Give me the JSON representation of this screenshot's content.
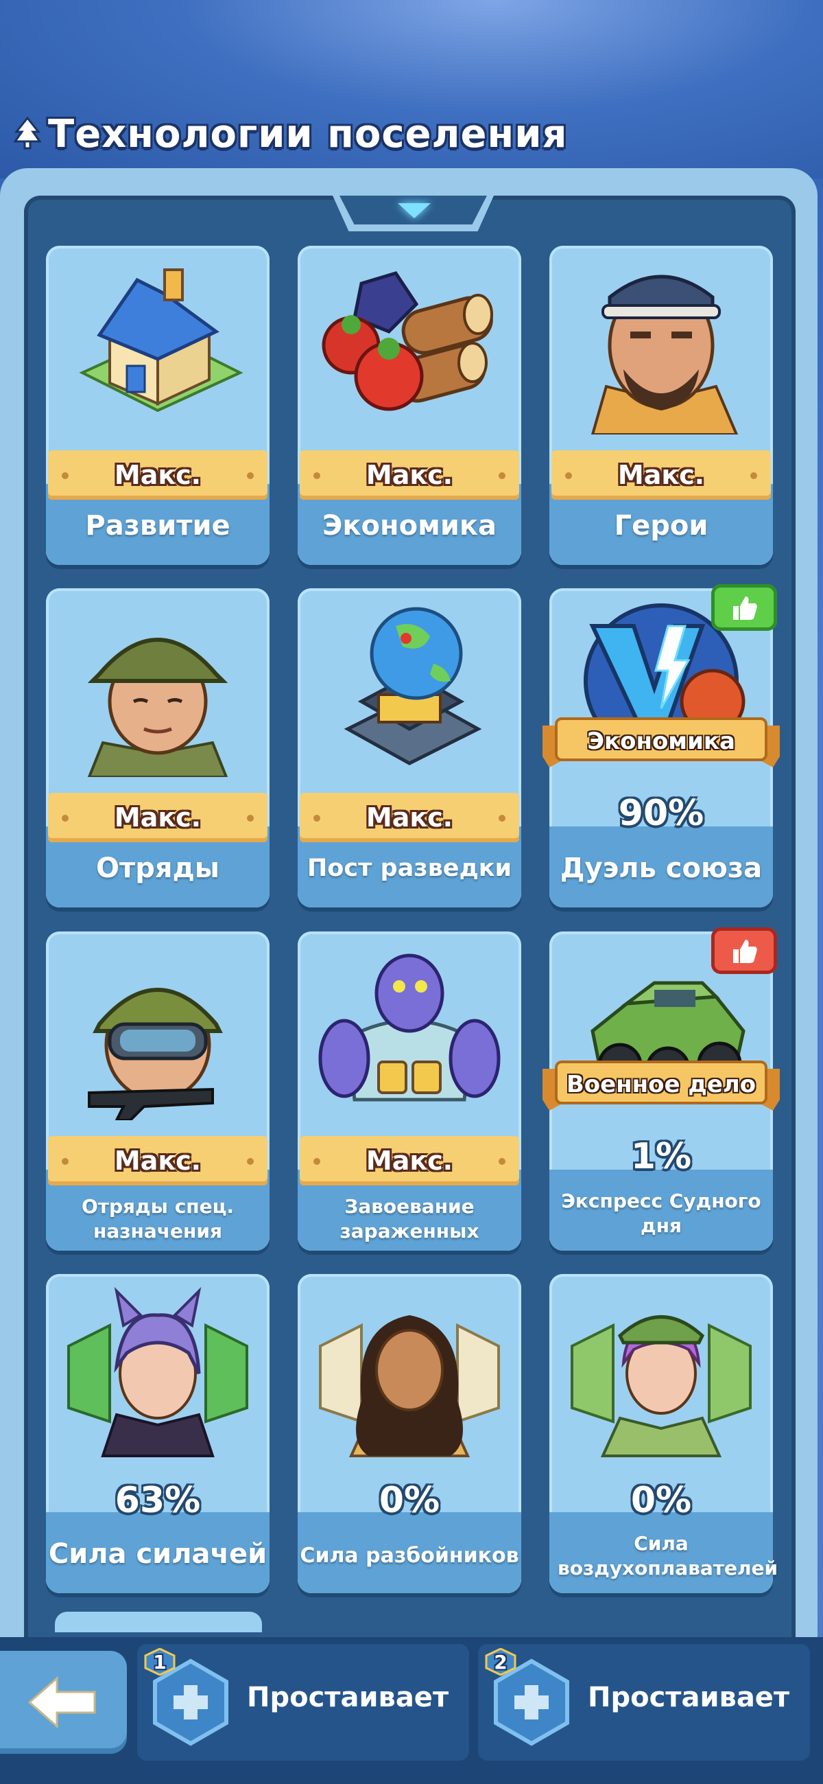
{
  "header": {
    "title": "Технологии поселения"
  },
  "cards": [
    {
      "label": "Развитие",
      "status": "Макс.",
      "art": "house-icon"
    },
    {
      "label": "Экономика",
      "status": "Макс.",
      "art": "resources-icon"
    },
    {
      "label": "Герои",
      "status": "Макс.",
      "art": "hero-portrait-icon"
    },
    {
      "label": "Отряды",
      "status": "Макс.",
      "art": "soldier-icon"
    },
    {
      "label": "Пост разведки",
      "status": "Макс.",
      "art": "globe-radar-icon"
    },
    {
      "label": "Дуэль союза",
      "tag": "Экономика",
      "percent": "90%",
      "art": "vs-emblem-icon",
      "thumb": "green"
    },
    {
      "label": "Отряды спец. назначения",
      "status": "Макс.",
      "art": "special-forces-icon"
    },
    {
      "label": "Завоевание зараженных",
      "status": "Макс.",
      "art": "zombie-icon"
    },
    {
      "label": "Экспресс Судного дня",
      "tag": "Военное дело",
      "percent": "1%",
      "art": "armored-truck-icon",
      "thumb": "red"
    },
    {
      "label": "Сила силачей",
      "percent": "63%",
      "art": "brute-hero-icon"
    },
    {
      "label": "Сила разбойников",
      "percent": "0%",
      "art": "raider-hero-icon"
    },
    {
      "label": "Сила воздухоплавателей",
      "percent": "0%",
      "art": "aeronaut-hero-icon"
    }
  ],
  "toolbar": {
    "slots": [
      {
        "number": "1",
        "label": "Простаивает"
      },
      {
        "number": "2",
        "label": "Простаивает"
      }
    ]
  },
  "colors": {
    "accent": "#f6cf72",
    "panel": "#2b5c8c",
    "card": "#9cd0f0",
    "green_thumb": "#5fcf4a",
    "red_thumb": "#ee5a4a"
  }
}
